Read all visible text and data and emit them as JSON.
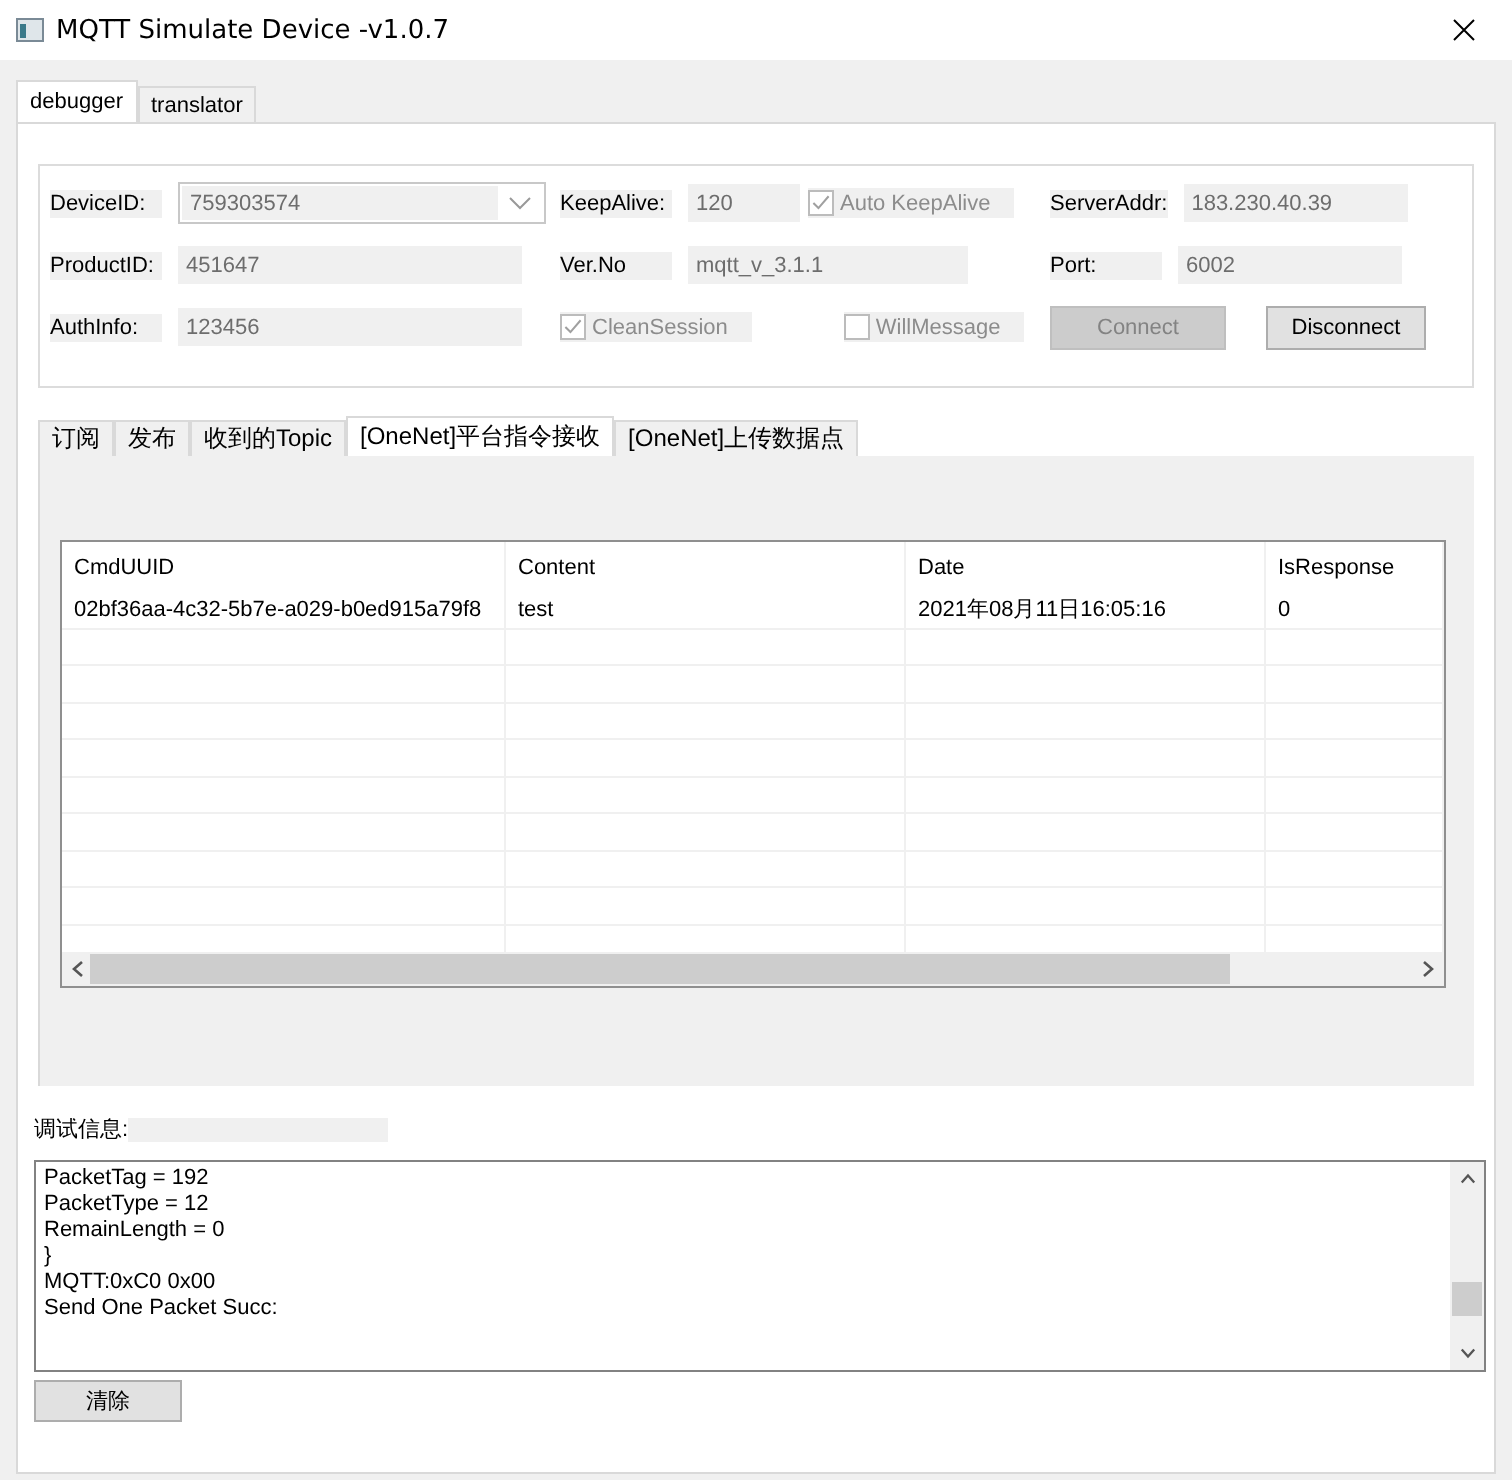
{
  "window": {
    "title": "MQTT Simulate Device  -v1.0.7"
  },
  "tabs": [
    {
      "label": "debugger",
      "selected": true
    },
    {
      "label": "translator",
      "selected": false
    }
  ],
  "connection": {
    "fields": [
      {
        "kind": "combo",
        "label": "DeviceID:",
        "value": "759303574"
      },
      {
        "kind": "text",
        "label": "ProductID:",
        "value": "451647"
      },
      {
        "kind": "text",
        "label": "AuthInfo:",
        "value": "123456"
      },
      {
        "kind": "text",
        "label": "KeepAlive:",
        "value": "120"
      },
      {
        "kind": "text",
        "label": "Ver.No",
        "value": "mqtt_v_3.1.1"
      },
      {
        "kind": "text",
        "label": "ServerAddr:",
        "value": "183.230.40.39"
      },
      {
        "kind": "text",
        "label": "Port:",
        "value": "6002"
      }
    ],
    "checkboxes": [
      {
        "label": "Auto KeepAlive",
        "checked": true,
        "disabled": true
      },
      {
        "label": "CleanSession",
        "checked": true,
        "disabled": true
      },
      {
        "label": "WillMessage",
        "checked": false,
        "disabled": true
      }
    ],
    "buttons": [
      {
        "label": "Connect",
        "disabled": true
      },
      {
        "label": "Disconnect",
        "disabled": false
      }
    ]
  },
  "sub_tabs": [
    {
      "label": "订阅",
      "selected": false
    },
    {
      "label": "发布",
      "selected": false
    },
    {
      "label": "收到的Topic",
      "selected": false
    },
    {
      "label": "[OneNet]平台指令接收",
      "selected": true
    },
    {
      "label": "[OneNet]上传数据点",
      "selected": false
    }
  ],
  "table": {
    "columns": [
      "CmdUUID",
      "Content",
      "Date",
      "IsResponse"
    ],
    "rows": [
      [
        "02bf36aa-4c32-5b7e-a029-b0ed915a79f8",
        "test",
        "2021年08月11日16:05:16",
        "0"
      ]
    ]
  },
  "debug": {
    "label": "调试信息:",
    "log": [
      "PacketTag = 192",
      "PacketType  = 12",
      "RemainLength  = 0",
      "}",
      "MQTT:0xC0 0x00",
      "Send One Packet Succ:"
    ],
    "clear_button": "清除"
  }
}
